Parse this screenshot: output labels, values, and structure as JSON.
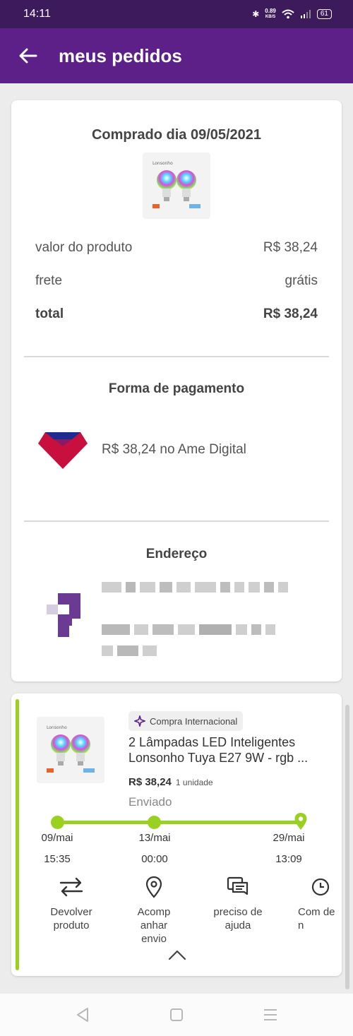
{
  "status_bar": {
    "time": "14:11",
    "network_speed": "0.89",
    "network_unit": "KB/S",
    "battery": "61"
  },
  "app_bar": {
    "title": "meus pedidos",
    "back_icon": "arrow-left-icon"
  },
  "summary": {
    "purchase_date": "Comprado dia 09/05/2021",
    "rows": [
      {
        "label": "valor do produto",
        "value": "R$ 38,24"
      },
      {
        "label": "frete",
        "value": "grátis"
      },
      {
        "label": "total",
        "value": "R$ 38,24"
      }
    ],
    "payment": {
      "title": "Forma de pagamento",
      "text": "R$ 38,24 no Ame Digital",
      "icon": "ame-digital-logo"
    },
    "address": {
      "title": "Endereço",
      "icon": "store-logo-icon"
    }
  },
  "order": {
    "badge": "Compra Internacional",
    "badge_icon": "airplane-icon",
    "product_name": "2 Lâmpadas LED Inteligentes Lonsonho Tuya E27 9W - rgb ...",
    "price": "R$ 38,24",
    "quantity": "1 unidade",
    "status": "Enviado",
    "timeline": [
      {
        "date": "09/mai",
        "time": "15:35"
      },
      {
        "date": "13/mai",
        "time": "00:00"
      },
      {
        "date": "29/mai",
        "time": "13:09"
      }
    ],
    "actions": [
      {
        "label": "Devolver produto",
        "icon": "exchange-arrows-icon"
      },
      {
        "label": "Acomp anhar envio",
        "icon": "location-pin-icon"
      },
      {
        "label": "preciso de ajuda",
        "icon": "chat-icon"
      },
      {
        "label": "Com de n",
        "icon": "refresh-icon"
      }
    ]
  },
  "nav": {
    "back": "back-triangle-icon",
    "home": "home-square-icon",
    "menu": "menu-lines-icon"
  },
  "colors": {
    "header": "#5c2088",
    "status_bar": "#3d1a5c",
    "progress": "#9ad121"
  }
}
